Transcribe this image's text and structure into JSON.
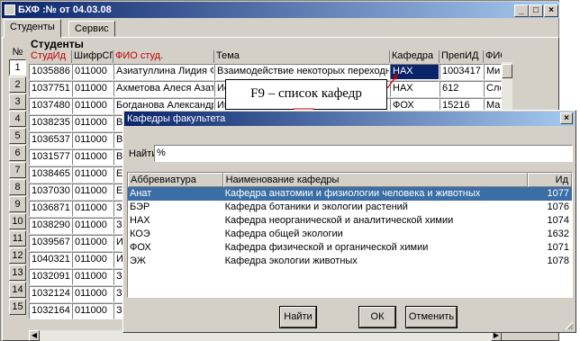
{
  "window": {
    "title": "БХФ :№  от 04.03.08",
    "minimize": "_",
    "maximize": "□",
    "close": "×"
  },
  "tabs": [
    {
      "label": "Студенты"
    },
    {
      "label": "Сервис"
    }
  ],
  "grid": {
    "title": "Студенты",
    "rownum_header": "№",
    "columns": [
      "СтудИд",
      "ШифрСП",
      "ФИО студ.",
      "Тема",
      "Кафедра",
      "ПрепИД",
      "ФИО"
    ],
    "rows": [
      {
        "n": "1",
        "c": [
          "1035886",
          "011000",
          "Азиатуллина Лидия Ф",
          "Взаимодействие некоторых переходных",
          "НАХ",
          "1003417",
          "Ми"
        ]
      },
      {
        "n": "2",
        "c": [
          "1037751",
          "011000",
          "Ахметова Алеся Азат",
          "Ис",
          "НАХ",
          "612",
          "Сло"
        ]
      },
      {
        "n": "3",
        "c": [
          "1037480",
          "011000",
          "Богданова Александр",
          "Ин",
          "ФОХ",
          "15216",
          "Маг"
        ]
      },
      {
        "n": "4",
        "c": [
          "1038235",
          "011000",
          "В",
          "",
          "",
          "",
          ""
        ]
      },
      {
        "n": "5",
        "c": [
          "1036537",
          "011000",
          "В",
          "",
          "",
          "",
          ""
        ]
      },
      {
        "n": "6",
        "c": [
          "1031577",
          "011000",
          "В",
          "",
          "",
          "",
          ""
        ]
      },
      {
        "n": "7",
        "c": [
          "1038465",
          "011000",
          "Е",
          "",
          "",
          "",
          ""
        ]
      },
      {
        "n": "8",
        "c": [
          "1037030",
          "011000",
          "Е",
          "",
          "",
          "",
          ""
        ]
      },
      {
        "n": "9",
        "c": [
          "1036871",
          "011000",
          "З",
          "",
          "",
          "",
          ""
        ]
      },
      {
        "n": "10",
        "c": [
          "1038290",
          "011000",
          "З",
          "",
          "",
          "",
          ""
        ]
      },
      {
        "n": "11",
        "c": [
          "1039567",
          "011000",
          "И",
          "",
          "",
          "",
          ""
        ]
      },
      {
        "n": "12",
        "c": [
          "1040321",
          "011000",
          "И",
          "",
          "",
          "",
          ""
        ]
      },
      {
        "n": "13",
        "c": [
          "1032091",
          "011000",
          "З",
          "",
          "",
          "",
          ""
        ]
      },
      {
        "n": "14",
        "c": [
          "1032124",
          "011000",
          "З",
          "",
          "",
          "",
          ""
        ]
      },
      {
        "n": "15",
        "c": [
          "1032164",
          "011000",
          "З",
          "",
          "",
          "",
          ""
        ]
      }
    ]
  },
  "callout": {
    "text": "F9 – список кафедр"
  },
  "dialog": {
    "title": "Кафедры факультета",
    "find_label": "Найти",
    "find_value": "%",
    "columns": [
      "Аббревиатура",
      "Наименование кафедры",
      "Ид"
    ],
    "rows": [
      {
        "abbr": "Анат",
        "name": "Кафедра анатомии и физиологии человека и животных",
        "id": "1077"
      },
      {
        "abbr": "БЭР",
        "name": "Кафедра ботаники и экологии растений",
        "id": "1076"
      },
      {
        "abbr": "НАХ",
        "name": "Кафедра неорганической и аналитической химии",
        "id": "1074"
      },
      {
        "abbr": "КОЭ",
        "name": "Кафедра общей экологии",
        "id": "1632"
      },
      {
        "abbr": "ФОХ",
        "name": "Кафедра физической и органической химии",
        "id": "1071"
      },
      {
        "abbr": "ЭЖ",
        "name": "Кафедра экологии животных",
        "id": "1078"
      }
    ],
    "buttons": {
      "find": "Найти",
      "ok": "ОК",
      "cancel": "Отменить"
    }
  },
  "colors": {
    "titlebar": "#0a246a",
    "selection": "#3a6ea5",
    "face": "#d4d0c8",
    "header_red": "#c00000"
  }
}
